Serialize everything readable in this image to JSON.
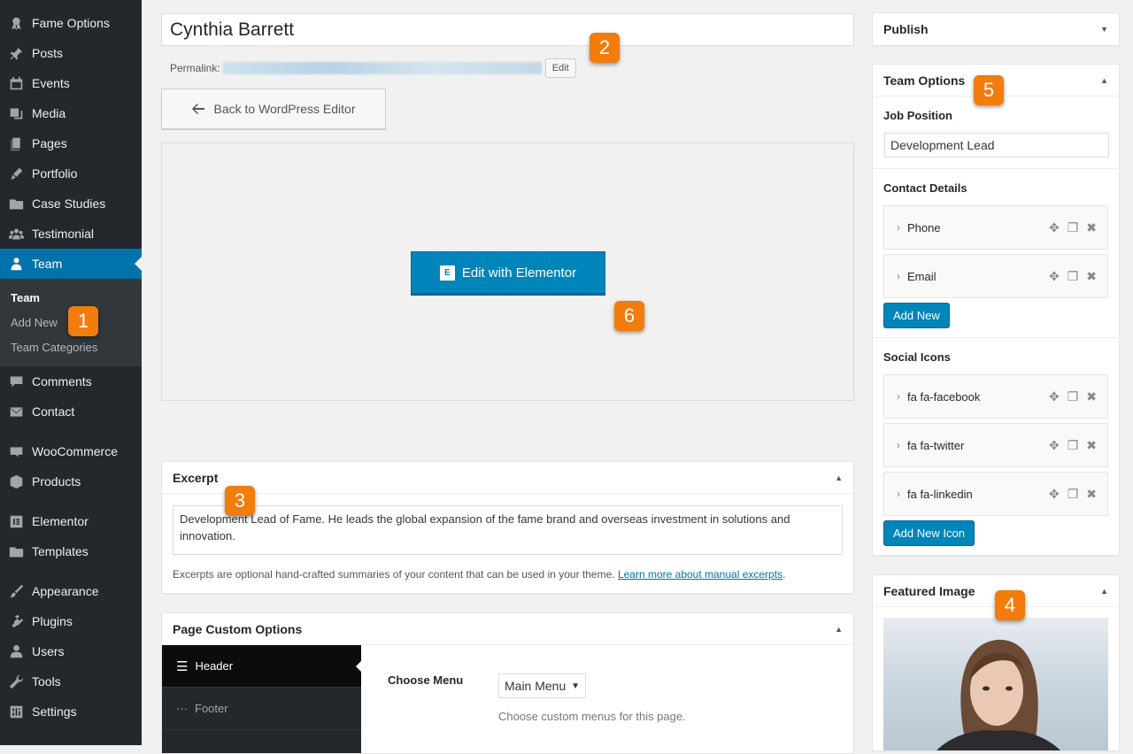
{
  "sidebar": {
    "items": [
      {
        "label": "Fame Options",
        "icon": "ribbon-icon"
      },
      {
        "label": "Posts",
        "icon": "pin-icon"
      },
      {
        "label": "Events",
        "icon": "calendar-icon"
      },
      {
        "label": "Media",
        "icon": "media-icon"
      },
      {
        "label": "Pages",
        "icon": "pages-icon"
      },
      {
        "label": "Portfolio",
        "icon": "portfolio-icon"
      },
      {
        "label": "Case Studies",
        "icon": "folder-icon"
      },
      {
        "label": "Testimonial",
        "icon": "people-icon"
      },
      {
        "label": "Team",
        "icon": "person-icon"
      },
      {
        "label": "Comments",
        "icon": "comment-icon"
      },
      {
        "label": "Contact",
        "icon": "mail-icon"
      },
      {
        "label": "WooCommerce",
        "icon": "woo-icon"
      },
      {
        "label": "Products",
        "icon": "box-icon"
      },
      {
        "label": "Elementor",
        "icon": "elementor-icon"
      },
      {
        "label": "Templates",
        "icon": "folder-icon"
      },
      {
        "label": "Appearance",
        "icon": "brush-icon"
      },
      {
        "label": "Plugins",
        "icon": "plugin-icon"
      },
      {
        "label": "Users",
        "icon": "user-icon"
      },
      {
        "label": "Tools",
        "icon": "wrench-icon"
      },
      {
        "label": "Settings",
        "icon": "settings-icon"
      }
    ],
    "submenu": [
      "Team",
      "Add New",
      "Team Categories"
    ]
  },
  "badges": [
    "1",
    "2",
    "3",
    "4",
    "5",
    "6"
  ],
  "editor": {
    "title": "Cynthia Barrett",
    "permalink_label": "Permalink:",
    "edit_label": "Edit",
    "back_label": "Back to WordPress Editor",
    "elementor_label": "Edit with Elementor",
    "elementor_logo": "E"
  },
  "excerpt": {
    "heading": "Excerpt",
    "text": "Development Lead of Fame. He leads the global expansion of the fame brand and overseas investment in solutions and innovation.",
    "help": "Excerpts are optional hand-crafted summaries of your content that can be used in your theme.",
    "link": "Learn more about manual excerpts"
  },
  "page_custom": {
    "heading": "Page Custom Options",
    "tabs": [
      "Header",
      "Footer"
    ],
    "choose_menu_label": "Choose Menu",
    "menu_value": "Main Menu",
    "menu_help": "Choose custom menus for this page."
  },
  "publish": {
    "heading": "Publish"
  },
  "team_options": {
    "heading": "Team Options",
    "job_label": "Job Position",
    "job_value": "Development Lead",
    "contact_label": "Contact Details",
    "contacts": [
      "Phone",
      "Email"
    ],
    "add_new": "Add New",
    "social_label": "Social Icons",
    "socials": [
      "fa fa-facebook",
      "fa fa-twitter",
      "fa fa-linkedin"
    ],
    "add_new_icon": "Add New Icon"
  },
  "featured": {
    "heading": "Featured Image"
  }
}
